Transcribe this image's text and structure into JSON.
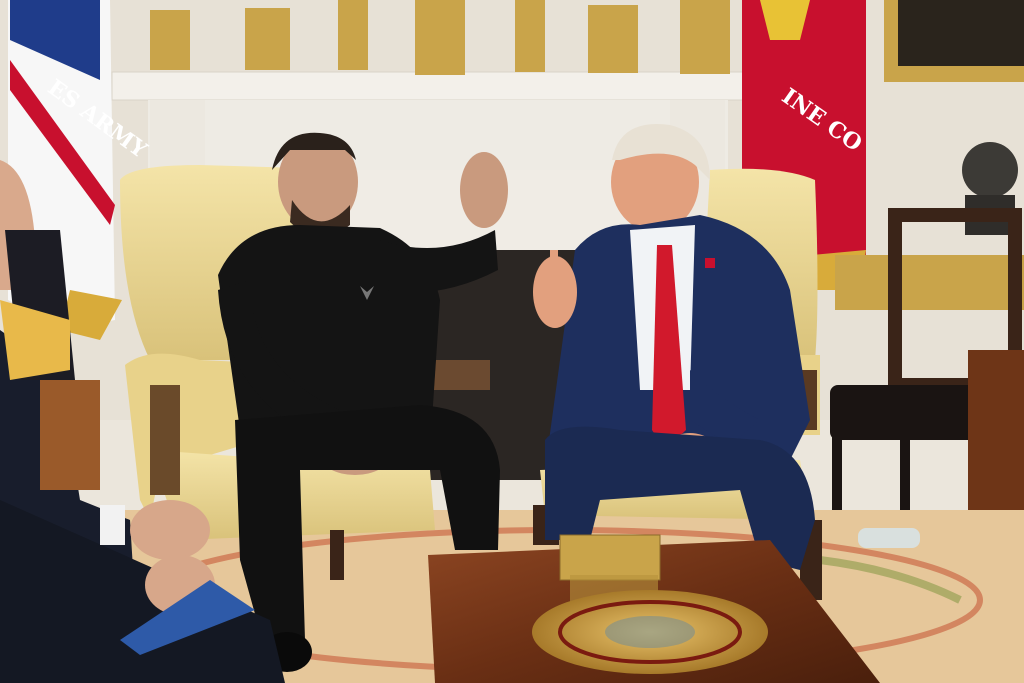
{
  "photo": {
    "flag_left_text": "ES ARMY",
    "flag_right_text": "INE CO",
    "colors": {
      "wall": "#ebe6dc",
      "mantel": "#f1eee7",
      "gold": "#c9a44a",
      "flag_red": "#c8102e",
      "chair_fabric": "#efdc9a",
      "suit_navy": "#1e2f5e",
      "black_outfit": "#141414",
      "tie_red": "#d1192c",
      "table_wood": "#7a3b1c",
      "rug": "#e6c79a"
    }
  }
}
